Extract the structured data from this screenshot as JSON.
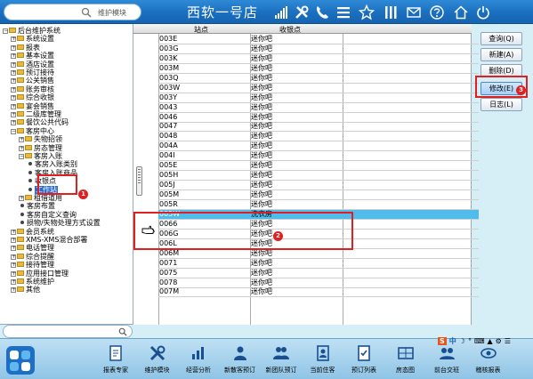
{
  "header": {
    "search_label": "维护模块",
    "title": "西软一号店"
  },
  "tree": {
    "items": [
      {
        "label": "后台维护系统",
        "level": 0,
        "kind": "folder",
        "expanded": true
      },
      {
        "label": "系统设置",
        "level": 1,
        "kind": "folder"
      },
      {
        "label": "报表",
        "level": 1,
        "kind": "folder"
      },
      {
        "label": "基本设置",
        "level": 1,
        "kind": "folder"
      },
      {
        "label": "酒店设置",
        "level": 1,
        "kind": "folder"
      },
      {
        "label": "预订接待",
        "level": 1,
        "kind": "folder"
      },
      {
        "label": "公关销售",
        "level": 1,
        "kind": "folder"
      },
      {
        "label": "账务审核",
        "level": 1,
        "kind": "folder"
      },
      {
        "label": "综合收银",
        "level": 1,
        "kind": "folder"
      },
      {
        "label": "宴会销售",
        "level": 1,
        "kind": "folder"
      },
      {
        "label": "二级库管理",
        "level": 1,
        "kind": "folder"
      },
      {
        "label": "餐饮公共代码",
        "level": 1,
        "kind": "folder"
      },
      {
        "label": "客房中心",
        "level": 1,
        "kind": "folder",
        "expanded": true
      },
      {
        "label": "失物招领",
        "level": 2,
        "kind": "folder"
      },
      {
        "label": "房态管理",
        "level": 2,
        "kind": "folder"
      },
      {
        "label": "客房入账",
        "level": 2,
        "kind": "folder",
        "expanded": true
      },
      {
        "label": "客房入账类别",
        "level": 3,
        "kind": "leaf"
      },
      {
        "label": "客房入账商品",
        "level": 3,
        "kind": "leaf"
      },
      {
        "label": "收银点",
        "level": 3,
        "kind": "leaf"
      },
      {
        "label": "工作站",
        "level": 3,
        "kind": "leaf",
        "selected": true
      },
      {
        "label": "租借道用",
        "level": 2,
        "kind": "folder"
      },
      {
        "label": "客房布置",
        "level": 2,
        "kind": "leaf"
      },
      {
        "label": "客房自定义查询",
        "level": 2,
        "kind": "leaf"
      },
      {
        "label": "损物/失物处理方式设置",
        "level": 2,
        "kind": "leaf"
      },
      {
        "label": "会员系统",
        "level": 1,
        "kind": "folder"
      },
      {
        "label": "XMS-XMS混合部署",
        "level": 1,
        "kind": "folder"
      },
      {
        "label": "电话管理",
        "level": 1,
        "kind": "folder"
      },
      {
        "label": "综合提醒",
        "level": 1,
        "kind": "folder"
      },
      {
        "label": "接待管理",
        "level": 1,
        "kind": "folder"
      },
      {
        "label": "应用接口管理",
        "level": 1,
        "kind": "folder"
      },
      {
        "label": "系统维护",
        "level": 1,
        "kind": "folder"
      },
      {
        "label": "其他",
        "level": 1,
        "kind": "folder"
      }
    ],
    "badge1": "1"
  },
  "table": {
    "headers": [
      "站点",
      "收银点"
    ],
    "rows": [
      [
        "003E",
        "迷你吧"
      ],
      [
        "003G",
        "迷你吧"
      ],
      [
        "003K",
        "迷你吧"
      ],
      [
        "003M",
        "迷你吧"
      ],
      [
        "003Q",
        "迷你吧"
      ],
      [
        "003W",
        "迷你吧"
      ],
      [
        "003Y",
        "迷你吧"
      ],
      [
        "0043",
        "迷你吧"
      ],
      [
        "0046",
        "迷你吧"
      ],
      [
        "0047",
        "迷你吧"
      ],
      [
        "0048",
        "迷你吧"
      ],
      [
        "004A",
        "迷你吧"
      ],
      [
        "004I",
        "迷你吧"
      ],
      [
        "005E",
        "迷你吧"
      ],
      [
        "005H",
        "迷你吧"
      ],
      [
        "005J",
        "迷你吧"
      ],
      [
        "005M",
        "迷你吧"
      ],
      [
        "005R",
        "迷你吧"
      ],
      [
        "005W",
        "洗衣房"
      ],
      [
        "0066",
        "迷你吧"
      ],
      [
        "006G",
        "迷你吧"
      ],
      [
        "006L",
        "迷你吧"
      ],
      [
        "006M",
        "迷你吧"
      ],
      [
        "0071",
        "迷你吧"
      ],
      [
        "0075",
        "迷你吧"
      ],
      [
        "0078",
        "迷你吧"
      ],
      [
        "007M",
        "迷你吧"
      ]
    ],
    "highlighted_row": 18,
    "badge2": "2"
  },
  "buttons": {
    "query": "查询(Q)",
    "new": "新建(A)",
    "delete": "删除(D)",
    "modify": "修改(E)",
    "log": "日志(L)",
    "badge3": "3"
  },
  "ime": {
    "s": "S",
    "zh": "中",
    "items": [
      "☽",
      "°",
      "⌨",
      "▲",
      "⚙",
      "☰"
    ]
  },
  "toolbar": {
    "items": [
      {
        "label": "报表专家",
        "icon": "report-icon"
      },
      {
        "label": "维护模块",
        "icon": "tools-icon"
      },
      {
        "label": "经营分析",
        "icon": "chart-icon"
      },
      {
        "label": "新散客预订",
        "icon": "person-icon"
      },
      {
        "label": "新团队预订",
        "icon": "group-icon"
      },
      {
        "label": "当前住客",
        "icon": "guest-icon"
      },
      {
        "label": "预订列表",
        "icon": "list-icon"
      },
      {
        "label": "房态图",
        "icon": "room-map-icon"
      },
      {
        "label": "前台交班",
        "icon": "handover-icon"
      },
      {
        "label": "稽核报表",
        "icon": "audit-icon"
      }
    ]
  },
  "colors": {
    "header": "#1a6fbf",
    "highlight_row": "#50bcec",
    "annotation_red": "#e02020",
    "background": "#d6eef6"
  }
}
